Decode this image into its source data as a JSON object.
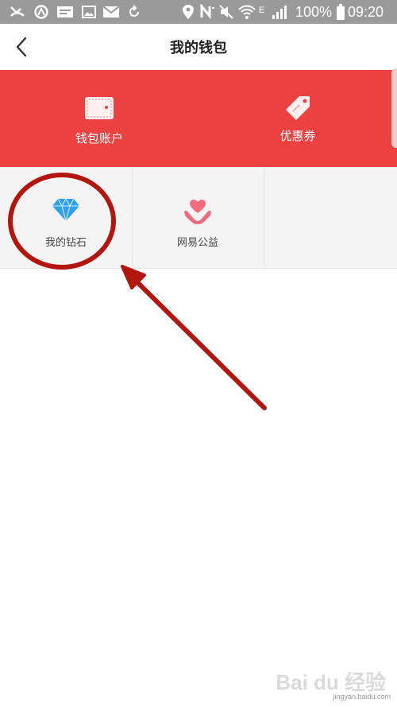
{
  "status_bar": {
    "battery_percent": "100%",
    "time": "09:20",
    "network_label": "E",
    "icons": [
      "missed-call-icon",
      "sync-icon",
      "news-icon",
      "gallery-icon",
      "mail-icon",
      "refresh-icon",
      "location-icon",
      "nfc-icon",
      "mute-icon",
      "wifi-icon",
      "signal-icon",
      "battery-icon"
    ]
  },
  "header": {
    "title": "我的钱包",
    "back_icon": "chevron-left-icon"
  },
  "banner": {
    "background_color": "#ec4141",
    "items": [
      {
        "label": "钱包账户",
        "icon": "wallet-icon"
      },
      {
        "label": "优惠券",
        "icon": "coupon-tag-icon"
      }
    ]
  },
  "grid": {
    "items": [
      {
        "label": "我的钻石",
        "icon": "diamond-icon",
        "icon_color": "#2da1f0"
      },
      {
        "label": "网易公益",
        "icon": "charity-heart-icon",
        "icon_color": "#f06b7e"
      }
    ]
  },
  "annotation": {
    "color": "#b3160f",
    "shapes": [
      "highlight-circle",
      "pointer-arrow"
    ]
  },
  "watermark": {
    "brand": "Bai du 经验",
    "url": "jingyan.baidu.com"
  }
}
